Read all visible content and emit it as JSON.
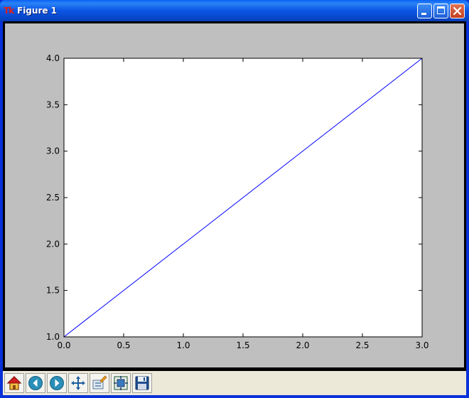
{
  "window": {
    "title": "Figure 1",
    "app_icon": "Tk",
    "controls": [
      "minimize",
      "maximize",
      "close"
    ]
  },
  "toolbar": {
    "buttons": [
      {
        "name": "home",
        "icon": "home-icon"
      },
      {
        "name": "back",
        "icon": "back-arrow-icon"
      },
      {
        "name": "forward",
        "icon": "forward-arrow-icon"
      },
      {
        "name": "pan",
        "icon": "pan-move-icon"
      },
      {
        "name": "zoom",
        "icon": "zoom-rect-icon"
      },
      {
        "name": "subplots",
        "icon": "subplots-config-icon"
      },
      {
        "name": "save",
        "icon": "save-floppy-icon"
      }
    ]
  },
  "colors": {
    "line": "#0000ff",
    "figure_bg": "#bfbfbf",
    "axes_bg": "#ffffff",
    "titlebar": "#0a55e3"
  },
  "chart_data": {
    "type": "line",
    "title": "",
    "xlabel": "",
    "ylabel": "",
    "xlim": [
      0.0,
      3.0
    ],
    "ylim": [
      1.0,
      4.0
    ],
    "xticks": [
      "0.0",
      "0.5",
      "1.0",
      "1.5",
      "2.0",
      "2.5",
      "3.0"
    ],
    "yticks": [
      "1.0",
      "1.5",
      "2.0",
      "2.5",
      "3.0",
      "3.5",
      "4.0"
    ],
    "grid": false,
    "series": [
      {
        "x": [
          0,
          1,
          2,
          3
        ],
        "y": [
          1,
          2,
          3,
          4
        ],
        "color": "#0000ff"
      }
    ]
  }
}
